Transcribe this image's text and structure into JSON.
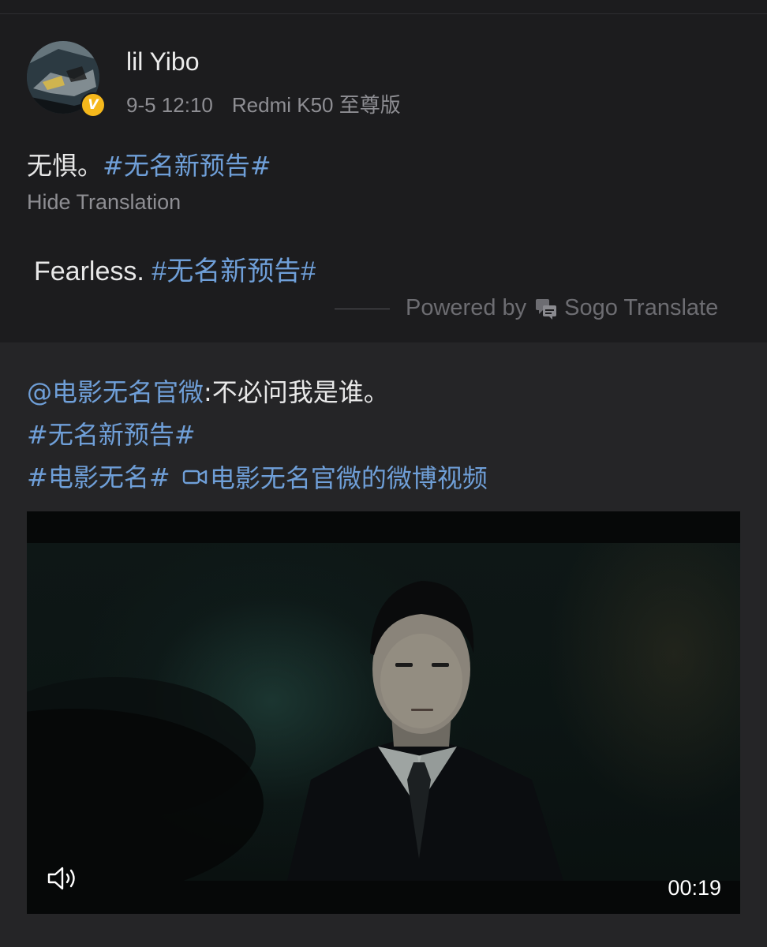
{
  "post": {
    "author": "lil Yibo",
    "time": "9-5 12:10",
    "device": "Redmi K50 至尊版",
    "verified_badge": "V",
    "text_plain": "无惧。",
    "text_hashtag": "#无名新预告#",
    "hide_translation_label": "Hide Translation",
    "translation_plain": "Fearless.",
    "translation_hashtag": "#无名新预告#",
    "powered_by_prefix": "Powered by",
    "powered_by_service": "Sogo Translate"
  },
  "retweet": {
    "mention": "@电影无名官微",
    "text": ":不必问我是谁。",
    "hashtag_1": "#无名新预告#",
    "hashtag_2": "#电影无名#",
    "video_link": "电影无名官微的微博视频"
  },
  "video": {
    "duration": "00:19",
    "mute_icon": "speaker-icon"
  },
  "colors": {
    "background": "#1c1c1e",
    "retweet_background": "#252527",
    "link": "#6f9fd8",
    "muted_text": "#8e8e93",
    "verified": "#f5b81c"
  }
}
